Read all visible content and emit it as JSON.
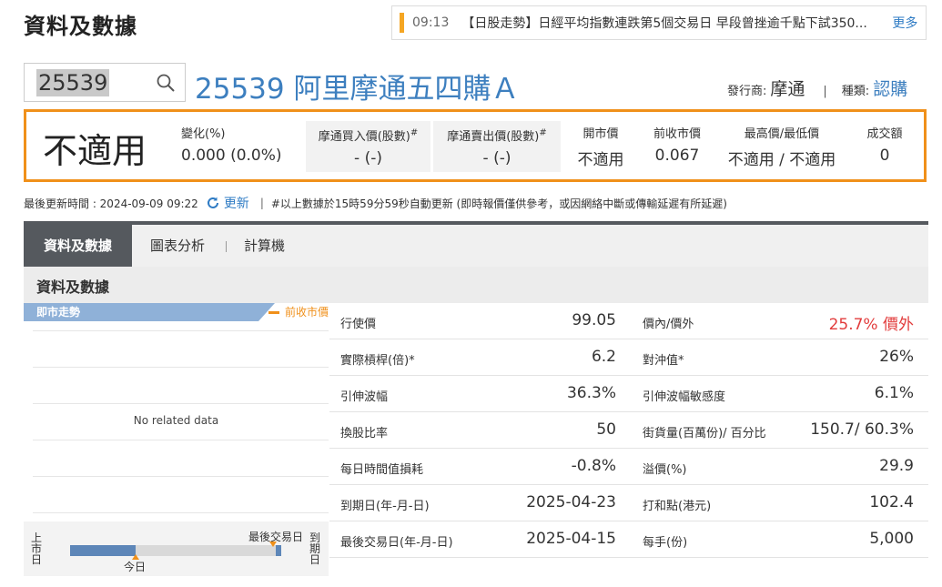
{
  "header": {
    "title": "資料及數據",
    "news": {
      "time": "09:13",
      "text": "【日股走勢】日經平均指數連跌第5個交易日 早段曾挫逾千點下試350...",
      "more": "更多"
    }
  },
  "search": {
    "value": "25539"
  },
  "product": {
    "name": "25539 阿里摩通五四購Ａ",
    "issuer_label": "發行商:",
    "issuer": "摩通",
    "type_label": "種類:",
    "type": "認購"
  },
  "quote": {
    "price": "不適用",
    "change_label": "變化(%)",
    "change": "0.000 (0.0%)",
    "bid_label": "摩通買入價(股數)",
    "bid_mark": "#",
    "bid": "- (-)",
    "ask_label": "摩通賣出價(股數)",
    "ask_mark": "#",
    "ask": "- (-)",
    "open_label": "開市價",
    "open": "不適用",
    "prev_close_label": "前收市價",
    "prev_close": "0.067",
    "high_low_label": "最高價/最低價",
    "high_low": "不適用 / 不適用",
    "turnover_label": "成交額",
    "turnover": "0"
  },
  "update": {
    "text": "最後更新時間 : 2024-09-09 09:22",
    "refresh": "更新",
    "note": "#以上數據於15時59分59秒自動更新 (即時報價僅供參考，或因網絡中斷或傳輸延遲有所延遲)"
  },
  "tabs": [
    "資料及數據",
    "圖表分析",
    "計算機"
  ],
  "section_title": "資料及數據",
  "chart": {
    "header": "即市走勢",
    "legend": "前收市價",
    "empty": "No related data",
    "listing_label": "上市日",
    "today_label": "今日",
    "last_trade_label": "最後交易日",
    "expiry_label": "到期日",
    "elapsed_fraction": 0.31
  },
  "table": {
    "left": [
      {
        "label": "行使價",
        "value": "99.05"
      },
      {
        "label": "實際槓桿(倍)*",
        "value": "6.2"
      },
      {
        "label": "引伸波幅",
        "value": "36.3%"
      },
      {
        "label": "換股比率",
        "value": "50"
      },
      {
        "label": "每日時間值損耗",
        "value": "-0.8%"
      },
      {
        "label": "到期日(年-月-日)",
        "value": "2025-04-23"
      },
      {
        "label": "最後交易日(年-月-日)",
        "value": "2025-04-15"
      }
    ],
    "right": [
      {
        "label": "價內/價外",
        "value": "25.7% 價外"
      },
      {
        "label": "對沖值*",
        "value": "26%"
      },
      {
        "label": "引伸波幅敏感度",
        "value": "6.1%"
      },
      {
        "label": "街貨量(百萬份)/ 百分比",
        "value": "150.7/ 60.3%"
      },
      {
        "label": "溢價(%)",
        "value": "29.9"
      },
      {
        "label": "打和點(港元)",
        "value": "102.4"
      },
      {
        "label": "每手(份)",
        "value": "5,000"
      }
    ]
  },
  "colors": {
    "accent": "#f0901a",
    "link": "#3d7fbf",
    "tab_dark": "#55595e",
    "negative": "#e23c3c"
  }
}
